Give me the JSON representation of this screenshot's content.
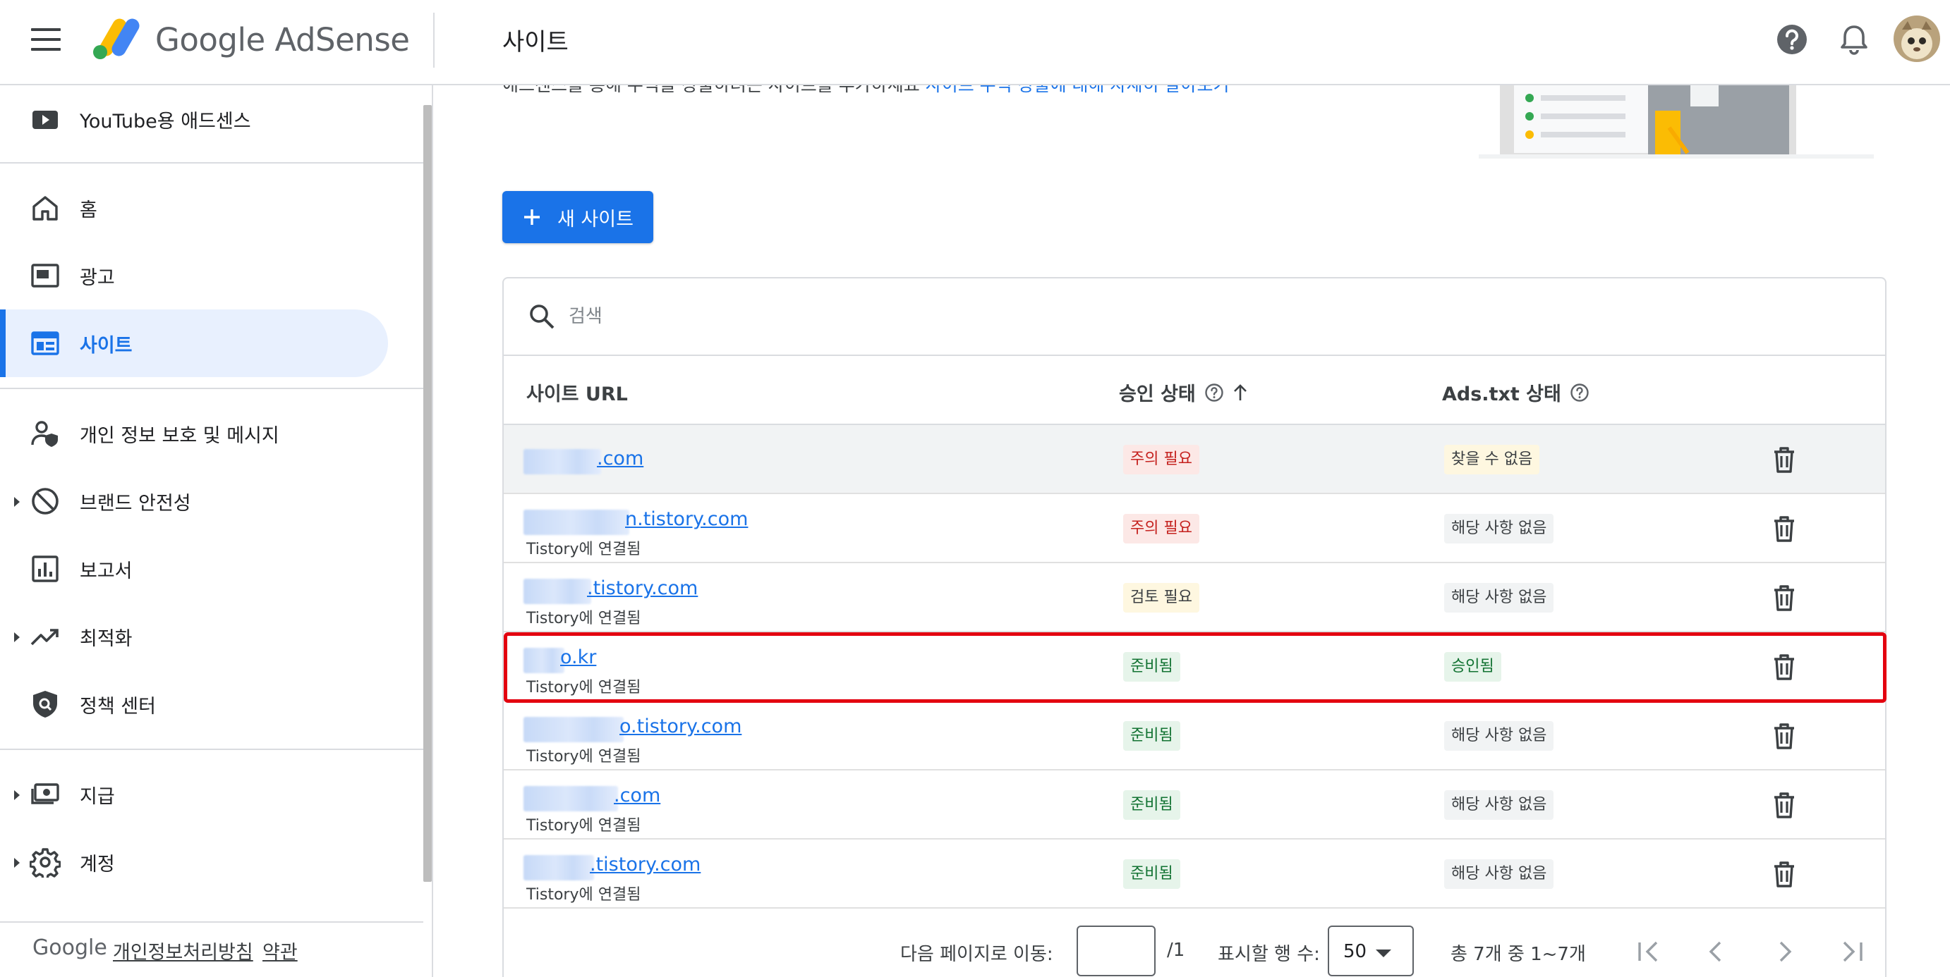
{
  "header": {
    "brand": "Google AdSense",
    "page_title": "사이트"
  },
  "sidebar": {
    "items": [
      {
        "label": "YouTube용 애드센스",
        "icon": "youtube-icon"
      },
      {
        "label": "홈",
        "icon": "home-icon"
      },
      {
        "label": "광고",
        "icon": "ads-icon"
      },
      {
        "label": "사이트",
        "icon": "sites-icon",
        "active": true
      },
      {
        "label": "개인 정보 보호 및 메시지",
        "icon": "privacy-icon"
      },
      {
        "label": "브랜드 안전성",
        "icon": "block-icon"
      },
      {
        "label": "보고서",
        "icon": "report-icon"
      },
      {
        "label": "최적화",
        "icon": "trending-icon"
      },
      {
        "label": "정책 센터",
        "icon": "shield-icon"
      },
      {
        "label": "지급",
        "icon": "payments-icon"
      },
      {
        "label": "계정",
        "icon": "gear-icon"
      }
    ],
    "footer": {
      "google": "Google",
      "privacy": "개인정보처리방침",
      "terms": "약관"
    }
  },
  "main": {
    "intro_text": "애드센스를 통해 수익을 창출하려는 사이트를 추가하세요",
    "intro_link": "사이트 수익 창출에 대해 자세히 알아보기",
    "new_site_label": "새 사이트",
    "search_placeholder": "검색",
    "columns": {
      "url": "사이트 URL",
      "status": "승인 상태",
      "ads_txt": "Ads.txt 상태"
    },
    "rows": [
      {
        "url": ".com",
        "sub": "",
        "status": "주의 필요",
        "status_tone": "red",
        "ads_txt": "찾을 수 없음",
        "ads_tone": "yellow"
      },
      {
        "url": "n.tistory.com",
        "sub": "Tistory에 연결됨",
        "status": "주의 필요",
        "status_tone": "red",
        "ads_txt": "해당 사항 없음",
        "ads_tone": "grey"
      },
      {
        "url": ".tistory.com",
        "sub": "Tistory에 연결됨",
        "status": "검토 필요",
        "status_tone": "yellow",
        "ads_txt": "해당 사항 없음",
        "ads_tone": "grey"
      },
      {
        "url": "o.kr",
        "sub": "Tistory에 연결됨",
        "status": "준비됨",
        "status_tone": "green",
        "ads_txt": "승인됨",
        "ads_tone": "green"
      },
      {
        "url": "o.tistory.com",
        "sub": "Tistory에 연결됨",
        "status": "준비됨",
        "status_tone": "green",
        "ads_txt": "해당 사항 없음",
        "ads_tone": "grey"
      },
      {
        "url": ".com",
        "sub": "Tistory에 연결됨",
        "status": "준비됨",
        "status_tone": "green",
        "ads_txt": "해당 사항 없음",
        "ads_tone": "grey"
      },
      {
        "url": ".tistory.com",
        "sub": "Tistory에 연결됨",
        "status": "준비됨",
        "status_tone": "green",
        "ads_txt": "해당 사항 없음",
        "ads_tone": "grey"
      }
    ],
    "pager": {
      "goto_label": "다음 페이지로 이동:",
      "page_input_value": "",
      "page_total": "/1",
      "rows_label": "표시할 행 수:",
      "rows_value": "50",
      "range_text": "총 7개 중 1~7개"
    }
  },
  "colors": {
    "accent": "#1a73e8",
    "highlight": "#e3000f",
    "chip_red": "#fce8e6",
    "chip_green": "#e6f4ea",
    "chip_yellow": "#fef7e0"
  }
}
